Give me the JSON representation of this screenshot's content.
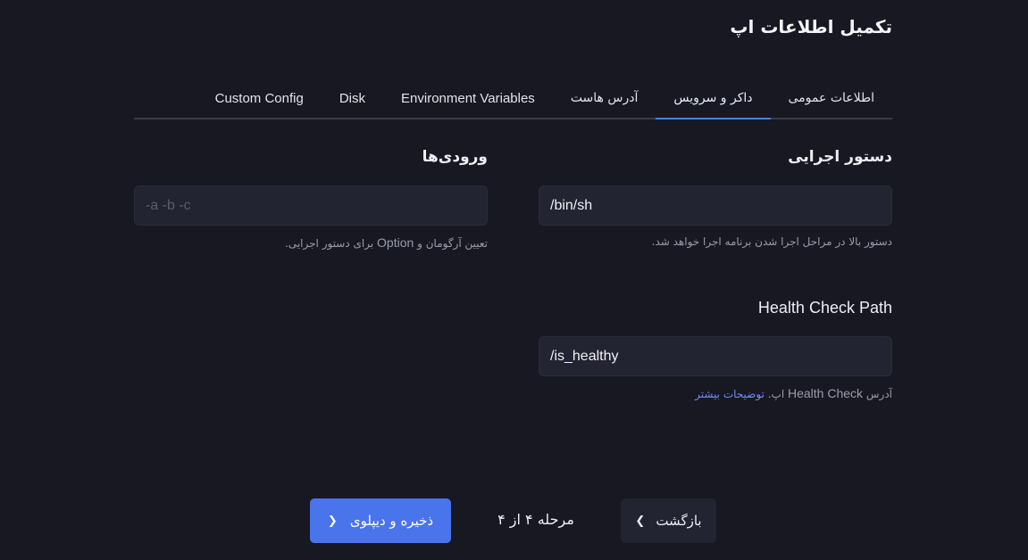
{
  "page": {
    "title": "تکمیل اطلاعات اپ"
  },
  "tabs": [
    {
      "label": "اطلاعات عمومی"
    },
    {
      "label": "داکر و سرویس"
    },
    {
      "label": "آدرس هاست"
    },
    {
      "label": "Environment Variables"
    },
    {
      "label": "Disk"
    },
    {
      "label": "Custom Config"
    }
  ],
  "active_tab": "داکر و سرویس",
  "command": {
    "label": "دستور اجرایی",
    "value": "/bin/sh",
    "help": "دستور بالا در مراحل اجرا شدن برنامه اجرا خواهد شد."
  },
  "args": {
    "label": "ورودی‌ها",
    "value": "",
    "placeholder": "-a -b -c",
    "help_prefix": "تعیین آرگومان و",
    "help_option": "Option",
    "help_suffix": "برای دستور اجرایی."
  },
  "health": {
    "label": "Health Check Path",
    "value": "/is_healthy",
    "help_prefix": "آدرس",
    "help_term": "Health Check",
    "help_suffix": "اپ.",
    "help_link": "توضیحات بیشتر"
  },
  "footer": {
    "deploy_label": "ذخیره و دیپلوی",
    "step_label": "مرحله ۴ از ۴",
    "back_label": "بازگشت"
  },
  "colors": {
    "background": "#171821",
    "input_background": "#232431",
    "accent": "#4a74ec",
    "link": "#6f8ff5"
  },
  "icons": {
    "deploy": "chevron-right-icon",
    "back": "chevron-left-icon"
  }
}
